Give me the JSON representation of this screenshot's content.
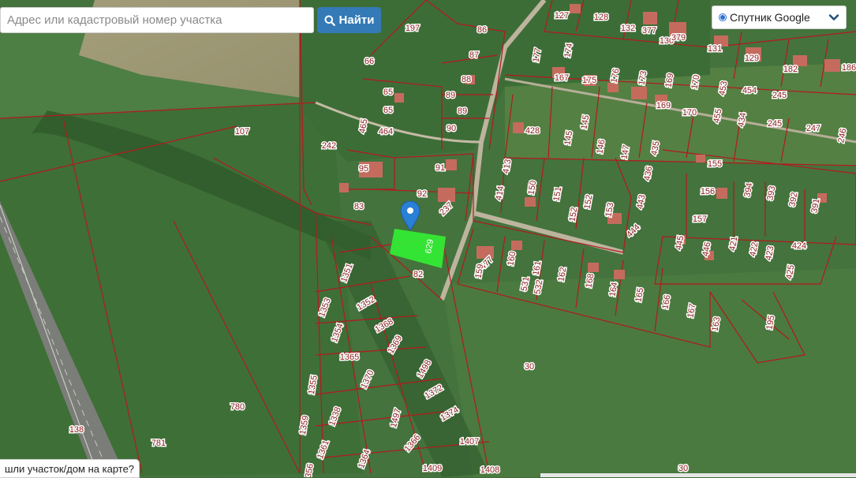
{
  "search": {
    "placeholder": "Адрес или кадастровый номер участка",
    "button_label": "Найти",
    "button_icon": "search-icon"
  },
  "layer_selector": {
    "selected": "Спутник Google",
    "icon": "chevron-down-icon"
  },
  "bottom_prompt": "шли участок/дом на карте?",
  "selected_parcel": {
    "label": "629",
    "color": "#33ee33"
  },
  "colors": {
    "parcel_border": "#b4191e",
    "label_text": "#8a1a1a",
    "label_bg": "#ffffff",
    "marker": "#2a7fd6",
    "button": "#337ab7"
  },
  "parcels": [
    {
      "label": "127"
    },
    {
      "label": "128"
    },
    {
      "label": "132"
    },
    {
      "label": "377"
    },
    {
      "label": "130"
    },
    {
      "label": "379"
    },
    {
      "label": "131"
    },
    {
      "label": "197"
    },
    {
      "label": "86"
    },
    {
      "label": "66"
    },
    {
      "label": "87"
    },
    {
      "label": "177"
    },
    {
      "label": "174"
    },
    {
      "label": "129"
    },
    {
      "label": "182"
    },
    {
      "label": "186"
    },
    {
      "label": "88"
    },
    {
      "label": "167"
    },
    {
      "label": "175"
    },
    {
      "label": "176"
    },
    {
      "label": "173"
    },
    {
      "label": "169"
    },
    {
      "label": "170"
    },
    {
      "label": "453"
    },
    {
      "label": "454"
    },
    {
      "label": "245"
    },
    {
      "label": "65"
    },
    {
      "label": "89"
    },
    {
      "label": "169"
    },
    {
      "label": "170"
    },
    {
      "label": "455"
    },
    {
      "label": "434"
    },
    {
      "label": "245"
    },
    {
      "label": "247"
    },
    {
      "label": "65"
    },
    {
      "label": "89"
    },
    {
      "label": "465"
    },
    {
      "label": "464"
    },
    {
      "label": "90"
    },
    {
      "label": "428"
    },
    {
      "label": "145"
    },
    {
      "label": "107"
    },
    {
      "label": "145"
    },
    {
      "label": "146"
    },
    {
      "label": "147"
    },
    {
      "label": "435"
    },
    {
      "label": "246"
    },
    {
      "label": "242"
    },
    {
      "label": "95"
    },
    {
      "label": "91"
    },
    {
      "label": "413"
    },
    {
      "label": "155"
    },
    {
      "label": "436"
    },
    {
      "label": "92"
    },
    {
      "label": "414"
    },
    {
      "label": "150"
    },
    {
      "label": "151"
    },
    {
      "label": "156"
    },
    {
      "label": "394"
    },
    {
      "label": "393"
    },
    {
      "label": "392"
    },
    {
      "label": "391"
    },
    {
      "label": "83"
    },
    {
      "label": "237"
    },
    {
      "label": "152"
    },
    {
      "label": "152"
    },
    {
      "label": "153"
    },
    {
      "label": "443"
    },
    {
      "label": "444"
    },
    {
      "label": "157"
    },
    {
      "label": "445"
    },
    {
      "label": "446"
    },
    {
      "label": "421"
    },
    {
      "label": "422"
    },
    {
      "label": "423"
    },
    {
      "label": "424"
    },
    {
      "label": "425"
    },
    {
      "label": "477"
    },
    {
      "label": "160"
    },
    {
      "label": "161"
    },
    {
      "label": "531"
    },
    {
      "label": "532"
    },
    {
      "label": "162"
    },
    {
      "label": "168"
    },
    {
      "label": "164"
    },
    {
      "label": "165"
    },
    {
      "label": "166"
    },
    {
      "label": "167"
    },
    {
      "label": "163"
    },
    {
      "label": "195"
    },
    {
      "label": "159"
    },
    {
      "label": "82"
    },
    {
      "label": "1351"
    },
    {
      "label": "1353"
    },
    {
      "label": "1352"
    },
    {
      "label": "1354"
    },
    {
      "label": "1368"
    },
    {
      "label": "1369"
    },
    {
      "label": "1365"
    },
    {
      "label": "1370"
    },
    {
      "label": "1498"
    },
    {
      "label": "1372"
    },
    {
      "label": "1355"
    },
    {
      "label": "1338"
    },
    {
      "label": "1497"
    },
    {
      "label": "1374"
    },
    {
      "label": "1359"
    },
    {
      "label": "1366"
    },
    {
      "label": "1407"
    },
    {
      "label": "1361"
    },
    {
      "label": "1364"
    },
    {
      "label": "1409"
    },
    {
      "label": "1408"
    },
    {
      "label": "1356"
    },
    {
      "label": "30"
    },
    {
      "label": "30"
    },
    {
      "label": "780"
    },
    {
      "label": "781"
    },
    {
      "label": "138"
    }
  ]
}
